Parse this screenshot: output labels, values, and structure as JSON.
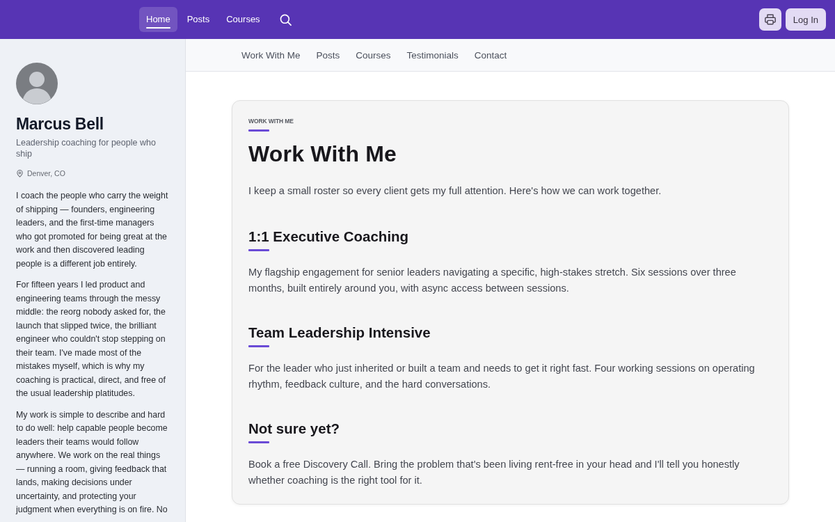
{
  "topbar": {
    "nav": [
      {
        "label": "Home",
        "selected": true
      },
      {
        "label": "Posts",
        "selected": false
      },
      {
        "label": "Courses",
        "selected": false
      }
    ],
    "login": "Log In"
  },
  "sidebar": {
    "name": "Marcus Bell",
    "tagline": "Leadership coaching for people who ship",
    "location": "Denver, CO",
    "bio": [
      "I coach the people who carry the weight of shipping — founders, engineering leaders, and the first-time managers who got promoted for being great at the work and then discovered leading people is a different job entirely.",
      "For fifteen years I led product and engineering teams through the messy middle: the reorg nobody asked for, the launch that slipped twice, the brilliant engineer who couldn't stop stepping on their team. I've made most of the mistakes myself, which is why my coaching is practical, direct, and free of the usual leadership platitudes.",
      "My work is simple to describe and hard to do well: help capable people become leaders their teams would follow anywhere. We work on the real things — running a room, giving feedback that lands, making decisions under uncertainty, and protecting your judgment when everything is on fire. No"
    ]
  },
  "subnav": [
    "Work With Me",
    "Posts",
    "Courses",
    "Testimonials",
    "Contact"
  ],
  "card": {
    "eyebrow": "WORK WITH ME",
    "title": "Work With Me",
    "intro": "I keep a small roster so every client gets my full attention. Here's how we can work together.",
    "sections": [
      {
        "heading": "1:1 Executive Coaching",
        "body": "My flagship engagement for senior leaders navigating a specific, high-stakes stretch. Six sessions over three months, built entirely around you, with async access between sessions."
      },
      {
        "heading": "Team Leadership Intensive",
        "body": "For the leader who just inherited or built a team and needs to get it right fast. Four working sessions on operating rhythm, feedback culture, and the hard conversations."
      },
      {
        "heading": "Not sure yet?",
        "body": "Book a free Discovery Call. Bring the problem that's been living rent-free in your head and I'll tell you honestly whether coaching is the right tool for it."
      }
    ]
  }
}
